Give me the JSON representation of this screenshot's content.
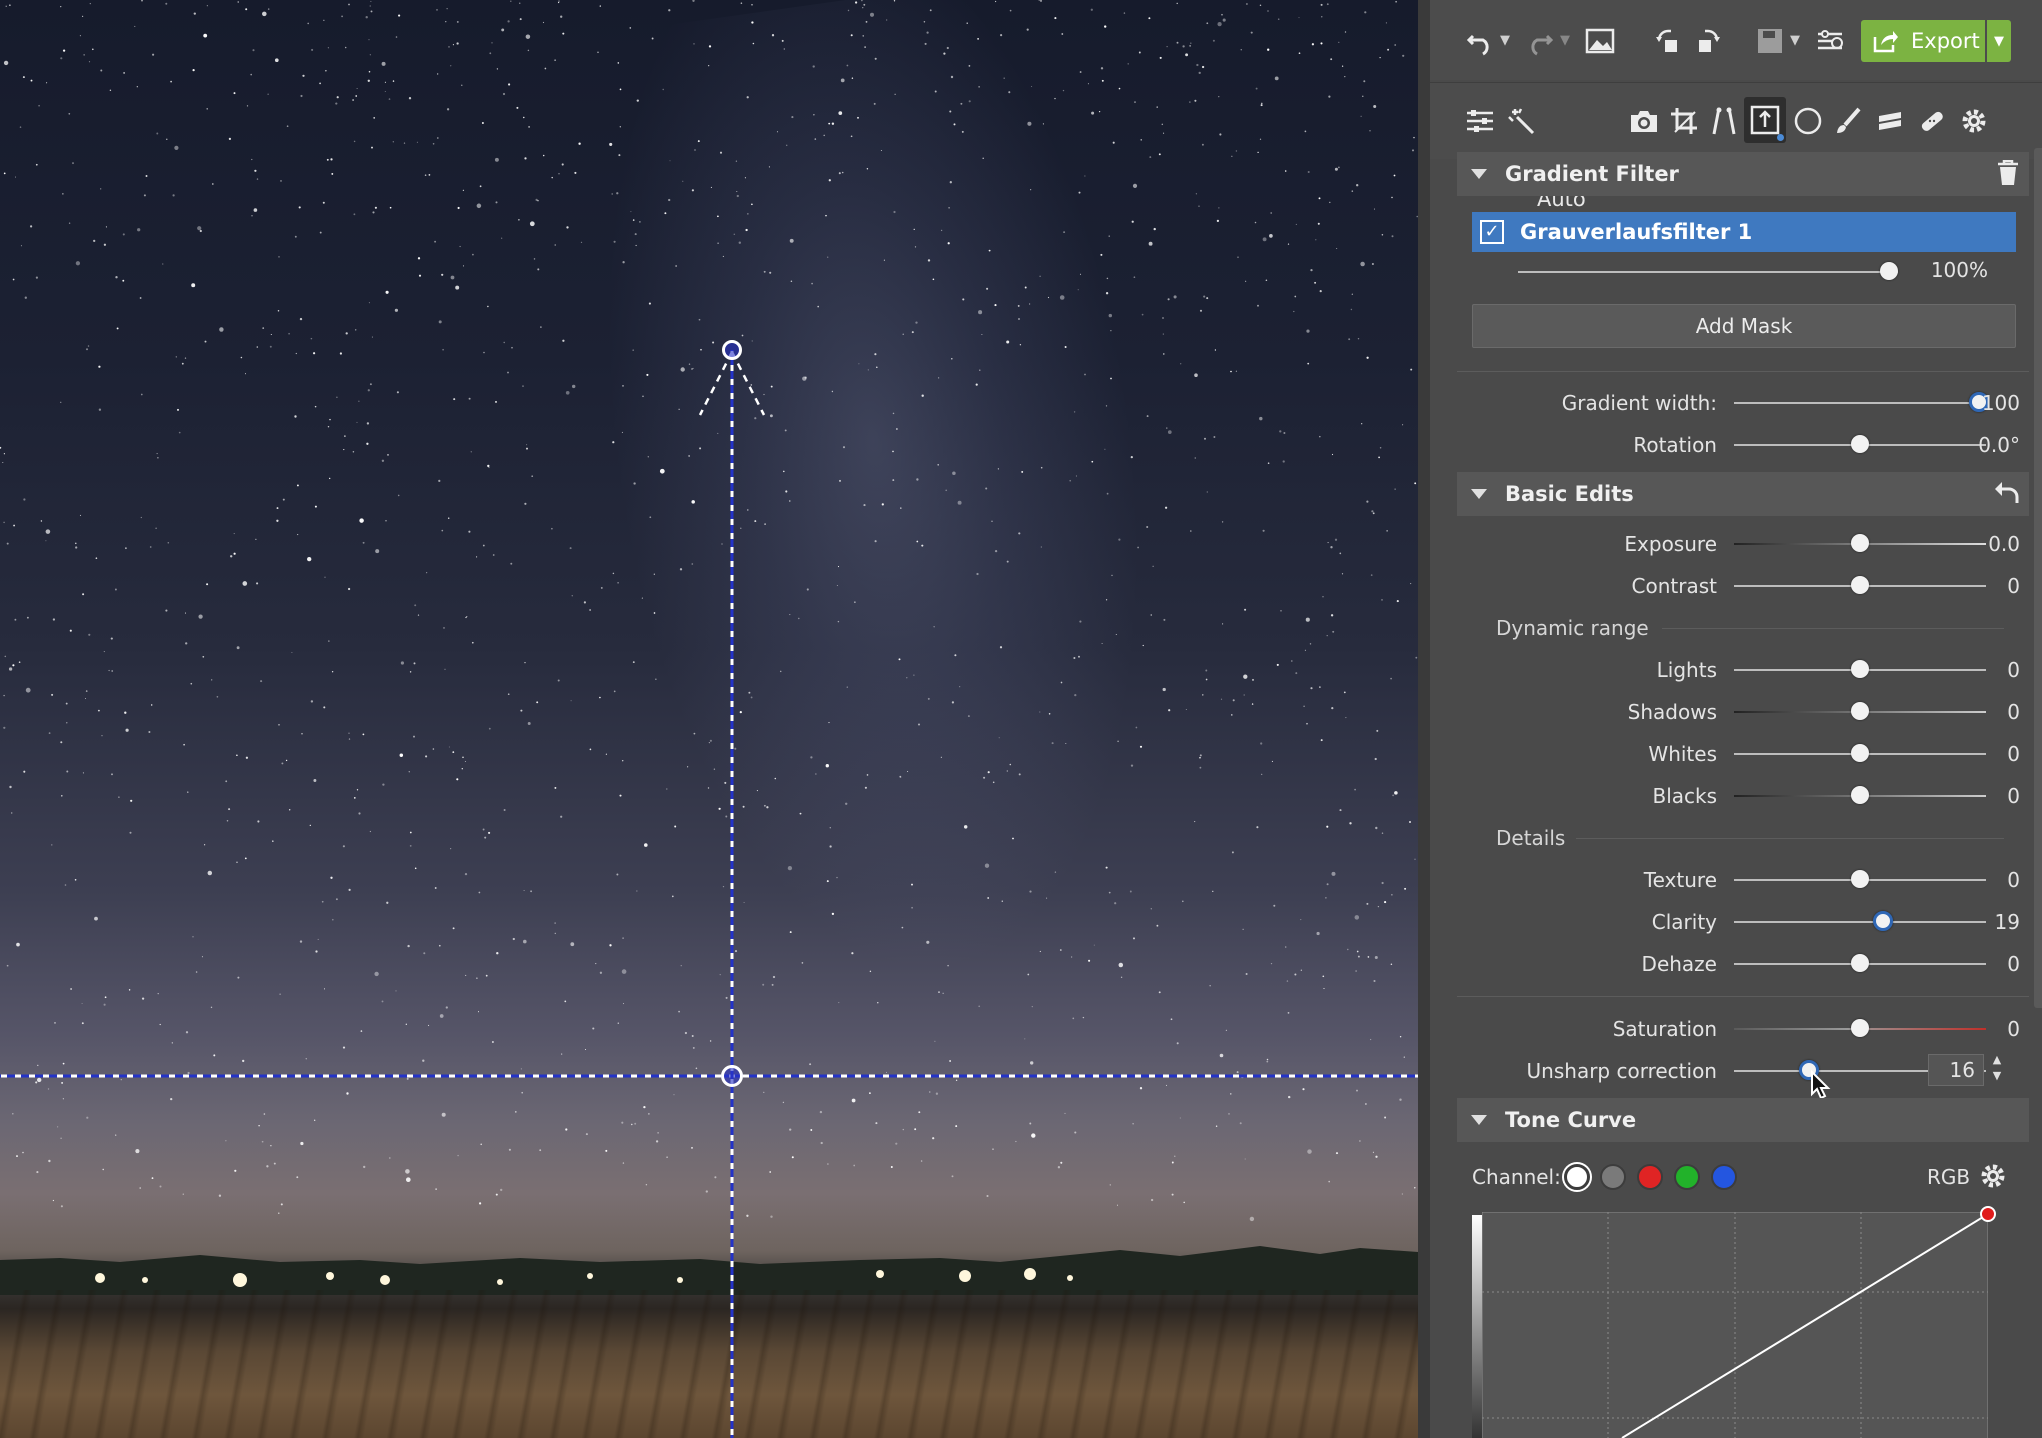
{
  "toolbar": {
    "undo_icon": "undo-icon",
    "redo_icon": "redo-icon",
    "export_label": "Export",
    "auto_label": "Auto"
  },
  "gradient_filter": {
    "title": "Gradient Filter",
    "filter_name": "Grauverlaufsfilter 1",
    "opacity": "100%",
    "opacity_fraction": 1.0,
    "add_mask_label": "Add Mask",
    "gradient_width_label": "Gradient width:",
    "gradient_width_value": "100",
    "gradient_width_fraction": 0.97,
    "rotation_label": "Rotation",
    "rotation_value": "0.0°",
    "rotation_fraction": 0.5
  },
  "basic_edits": {
    "title": "Basic Edits",
    "exposure_label": "Exposure",
    "exposure_value": "0.0",
    "contrast_label": "Contrast",
    "contrast_value": "0",
    "dynamic_range_label": "Dynamic range",
    "lights_label": "Lights",
    "lights_value": "0",
    "shadows_label": "Shadows",
    "shadows_value": "0",
    "whites_label": "Whites",
    "whites_value": "0",
    "blacks_label": "Blacks",
    "blacks_value": "0",
    "details_label": "Details",
    "texture_label": "Texture",
    "texture_value": "0",
    "clarity_label": "Clarity",
    "clarity_value": "19",
    "dehaze_label": "Dehaze",
    "dehaze_value": "0",
    "saturation_label": "Saturation",
    "saturation_value": "0",
    "unsharp_label": "Unsharp correction",
    "unsharp_value": "16"
  },
  "tone_curve": {
    "title": "Tone Curve",
    "channel_label": "Channel:",
    "mode_label": "RGB",
    "channels": [
      "white",
      "gray",
      "red",
      "green",
      "blue"
    ]
  },
  "colors": {
    "accent_blue": "#3f79c0",
    "export_green": "#7cb342"
  }
}
